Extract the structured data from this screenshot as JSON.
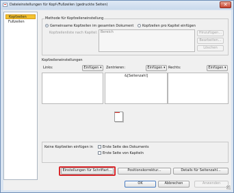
{
  "window": {
    "title": "Dateieinstellungen für Kopf-/Fußzeilen (gedruckte Seiten)",
    "close_glyph": "✕"
  },
  "sidebar": {
    "items": [
      {
        "label": "Kopfzeilen",
        "selected": true
      },
      {
        "label": "Fußzeilen",
        "selected": false
      }
    ]
  },
  "method_group": {
    "label": "Methode für Kopfzeileneinstellung",
    "option_shared": "Gemeinsame Kopfzeilen im gesamten Dokument",
    "option_per_chapter": "Kopfzeilen pro Kapitel einfügen",
    "selected_option": "Gemeinsame Kopfzeilen im gesamten Dokument",
    "list_label": "Kopfzeilenliste nach Kapitel:",
    "range_placeholder": "Bereich",
    "buttons": {
      "insert": "Hinzufügen...",
      "edit": "Bearbeiten...",
      "delete": "Löschen"
    }
  },
  "header_settings": {
    "label": "Kopfzeileneinstellungen",
    "left": {
      "label": "Links:",
      "insert": "Einfügen ▾",
      "value": ""
    },
    "center": {
      "label": "Zentrieren:",
      "insert": "Einfügen ▾",
      "value": "&[Seitenzahl]"
    },
    "right": {
      "label": "Rechts:",
      "insert": "Einfügen ▾",
      "value": ""
    }
  },
  "no_header": {
    "label": "Keine Kopfzeilen einfügen in",
    "options": [
      {
        "label": "Erste Seite des Dokuments",
        "checked": false
      },
      {
        "label": "Erste Seite von Kapiteln",
        "checked": false
      }
    ]
  },
  "actions": {
    "font_settings": "Einstellungen für Schriftart...",
    "position_correction": "Positionskorrektur...",
    "page_number_details": "Details für Seitenzahl..."
  },
  "footer": {
    "ok": "OK",
    "cancel": "Abbrechen",
    "apply": "Anwenden"
  },
  "colors": {
    "selection": "#f2c230",
    "highlight": "#d9262a",
    "window_frame": "#d9e4f1"
  }
}
